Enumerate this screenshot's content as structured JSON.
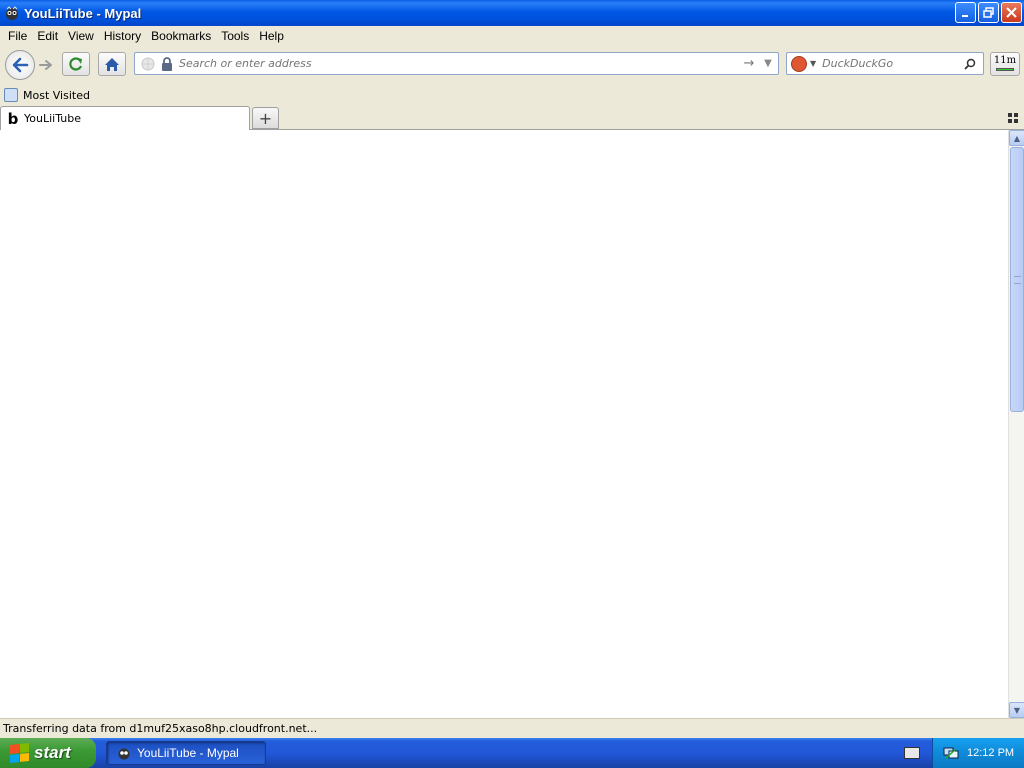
{
  "window": {
    "title": "YouLiiTube - Mypal",
    "buttons": [
      "minimize",
      "maximize",
      "close"
    ]
  },
  "menubar": {
    "items": [
      "File",
      "Edit",
      "View",
      "History",
      "Bookmarks",
      "Tools",
      "Help"
    ]
  },
  "navbar": {
    "address_placeholder": "Search or enter address",
    "search_placeholder": "DuckDuckGo",
    "addon_label": "11m"
  },
  "bookmarks": {
    "items": [
      {
        "label": "Most Visited"
      }
    ]
  },
  "tabs": [
    {
      "label": "YouLiiTube",
      "favicon": "b",
      "active": true
    }
  ],
  "status": {
    "text": "Transferring data from d1muf25xaso8hp.cloudfront.net..."
  },
  "taskbar": {
    "start_label": "start",
    "tasks": [
      {
        "label": "YouLiiTube - Mypal"
      }
    ],
    "clock": "12:12 PM"
  },
  "colors": {
    "titlebar": "#0058e4",
    "taskbar": "#245edb",
    "start": "#3d9b35",
    "tray": "#0f8ad8",
    "chrome": "#ece9d8"
  }
}
